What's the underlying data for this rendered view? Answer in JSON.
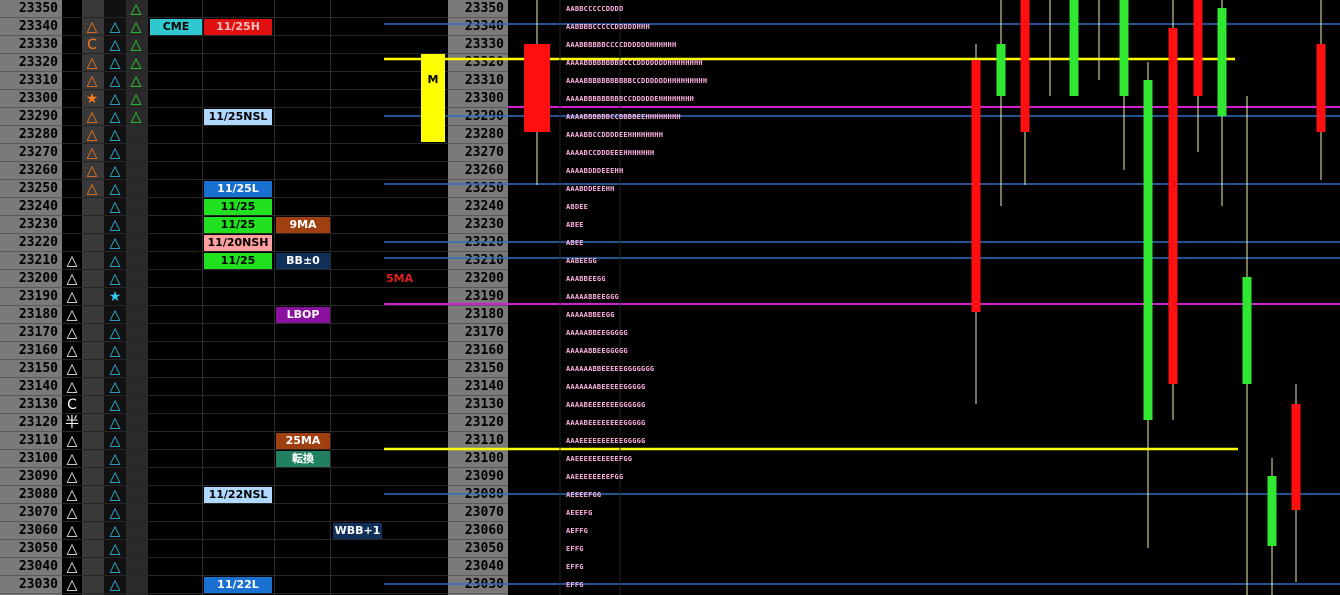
{
  "prices": [
    "23350",
    "23340",
    "23330",
    "23320",
    "23310",
    "23300",
    "23290",
    "23280",
    "23270",
    "23260",
    "23250",
    "23240",
    "23230",
    "23220",
    "23210",
    "23200",
    "23190",
    "23180",
    "23170",
    "23160",
    "23150",
    "23140",
    "23130",
    "23120",
    "23110",
    "23100",
    "23090",
    "23080",
    "23070",
    "23060",
    "23050",
    "23040",
    "23030"
  ],
  "col1_marks": [
    {
      "row": 14,
      "glyph": "△",
      "color": "#ffffff",
      "name": "triangle-icon"
    },
    {
      "row": 15,
      "glyph": "△",
      "color": "#ffffff",
      "name": "triangle-icon"
    },
    {
      "row": 16,
      "glyph": "△",
      "color": "#ffffff",
      "name": "triangle-icon"
    },
    {
      "row": 17,
      "glyph": "△",
      "color": "#ffffff",
      "name": "triangle-icon"
    },
    {
      "row": 18,
      "glyph": "△",
      "color": "#ffffff",
      "name": "triangle-icon"
    },
    {
      "row": 19,
      "glyph": "△",
      "color": "#ffffff",
      "name": "triangle-icon"
    },
    {
      "row": 20,
      "glyph": "△",
      "color": "#ffffff",
      "name": "triangle-icon"
    },
    {
      "row": 21,
      "glyph": "△",
      "color": "#ffffff",
      "name": "triangle-icon"
    },
    {
      "row": 22,
      "glyph": "C",
      "color": "#ffffff",
      "name": "c-mark-icon"
    },
    {
      "row": 23,
      "glyph": "半",
      "color": "#ffffff",
      "name": "half-mark-icon"
    },
    {
      "row": 24,
      "glyph": "△",
      "color": "#ffffff",
      "name": "triangle-icon"
    },
    {
      "row": 25,
      "glyph": "△",
      "color": "#ffffff",
      "name": "triangle-icon"
    },
    {
      "row": 26,
      "glyph": "△",
      "color": "#ffffff",
      "name": "triangle-icon"
    },
    {
      "row": 27,
      "glyph": "△",
      "color": "#ffffff",
      "name": "triangle-icon"
    },
    {
      "row": 28,
      "glyph": "△",
      "color": "#ffffff",
      "name": "triangle-icon"
    },
    {
      "row": 29,
      "glyph": "△",
      "color": "#ffffff",
      "name": "triangle-icon"
    },
    {
      "row": 30,
      "glyph": "△",
      "color": "#ffffff",
      "name": "triangle-icon"
    },
    {
      "row": 31,
      "glyph": "△",
      "color": "#ffffff",
      "name": "triangle-icon"
    },
    {
      "row": 32,
      "glyph": "△",
      "color": "#ffffff",
      "name": "triangle-icon"
    }
  ],
  "col2_marks": [
    {
      "row": 1,
      "glyph": "△",
      "color": "#ff7a20",
      "name": "triangle-icon"
    },
    {
      "row": 2,
      "glyph": "C",
      "color": "#ff7a20",
      "name": "c-mark-icon"
    },
    {
      "row": 3,
      "glyph": "△",
      "color": "#ff7a20",
      "name": "triangle-icon"
    },
    {
      "row": 4,
      "glyph": "△",
      "color": "#ff7a20",
      "name": "triangle-icon"
    },
    {
      "row": 5,
      "glyph": "★",
      "color": "#ff7a20",
      "name": "star-icon"
    },
    {
      "row": 6,
      "glyph": "△",
      "color": "#ff7a20",
      "name": "triangle-icon"
    },
    {
      "row": 7,
      "glyph": "△",
      "color": "#ff7a20",
      "name": "triangle-icon"
    },
    {
      "row": 8,
      "glyph": "△",
      "color": "#ff7a20",
      "name": "triangle-icon"
    },
    {
      "row": 9,
      "glyph": "△",
      "color": "#ff7a20",
      "name": "triangle-icon"
    },
    {
      "row": 10,
      "glyph": "△",
      "color": "#ff7a20",
      "name": "triangle-icon"
    }
  ],
  "col3_marks_all_rows": {
    "from": 1,
    "to": 32,
    "glyph": "△",
    "color": "#30c8f0",
    "star_row": 16,
    "star_glyph": "★"
  },
  "col4_marks": [
    {
      "row": 0,
      "glyph": "△",
      "color": "#30e030",
      "name": "triangle-icon"
    },
    {
      "row": 1,
      "glyph": "△",
      "color": "#30e030",
      "name": "triangle-icon"
    },
    {
      "row": 2,
      "glyph": "△",
      "color": "#30e030",
      "name": "triangle-icon"
    },
    {
      "row": 3,
      "glyph": "△",
      "color": "#30e030",
      "name": "triangle-icon"
    },
    {
      "row": 4,
      "glyph": "△",
      "color": "#30e030",
      "name": "triangle-icon"
    },
    {
      "row": 5,
      "glyph": "△",
      "color": "#30e030",
      "name": "triangle-icon"
    },
    {
      "row": 6,
      "glyph": "△",
      "color": "#30e030",
      "name": "triangle-icon"
    }
  ],
  "labels": [
    {
      "row": 1,
      "col": "a",
      "text": "CME",
      "bg": "#30c8d0",
      "fg": "#000000"
    },
    {
      "row": 1,
      "col": "b",
      "text": "11/25H",
      "bg": "#e01010",
      "fg": "#ffc0c0"
    },
    {
      "row": 6,
      "col": "b",
      "text": "11/25NSL",
      "bg": "#b0d8ff",
      "fg": "#000000"
    },
    {
      "row": 10,
      "col": "b",
      "text": "11/25L",
      "bg": "#1a70d0",
      "fg": "#ffffff"
    },
    {
      "row": 11,
      "col": "b",
      "text": "11/25",
      "bg": "#20e020",
      "fg": "#000000"
    },
    {
      "row": 12,
      "col": "b",
      "text": "11/25",
      "bg": "#20e020",
      "fg": "#000000"
    },
    {
      "row": 12,
      "col": "c",
      "text": "9MA",
      "bg": "#a04010",
      "fg": "#ffffff"
    },
    {
      "row": 13,
      "col": "b",
      "text": "11/20NSH",
      "bg": "#ffa0a0",
      "fg": "#000000"
    },
    {
      "row": 14,
      "col": "b",
      "text": "11/25",
      "bg": "#20e020",
      "fg": "#000000"
    },
    {
      "row": 14,
      "col": "c",
      "text": "BB±0",
      "bg": "#10305a",
      "fg": "#ffffff"
    },
    {
      "row": 17,
      "col": "c",
      "text": "LBOP",
      "bg": "#8a10a0",
      "fg": "#ffffff"
    },
    {
      "row": 24,
      "col": "c",
      "text": "25MA",
      "bg": "#a04010",
      "fg": "#ffffff"
    },
    {
      "row": 25,
      "col": "c",
      "text": "転換",
      "bg": "#208060",
      "fg": "#ffffff"
    },
    {
      "row": 27,
      "col": "b",
      "text": "11/22NSL",
      "bg": "#b0d8ff",
      "fg": "#000000"
    },
    {
      "row": 29,
      "col": "d",
      "text": "WBB+1",
      "bg": "#10305a",
      "fg": "#ffffff"
    },
    {
      "row": 32,
      "col": "b",
      "text": "11/22L",
      "bg": "#1a70d0",
      "fg": "#ffffff"
    }
  ],
  "five_ma_label": "5MA",
  "m_label": "M",
  "tpo_rows": [
    {
      "row": 0,
      "text": "AABBCCCCCDDDD"
    },
    {
      "row": 1,
      "text": "AABBBBCCCCCDDDDDHHH"
    },
    {
      "row": 2,
      "text": "AAABBBBBBCCCCDDDDDDHHHHHH"
    },
    {
      "row": 3,
      "text": "AAAABBBBBBBBBCCCDDDDDDDHHHHHHHH"
    },
    {
      "row": 4,
      "text": "AAAABBBBBBBBBBBCCDDDDDDHHHHHHHHH"
    },
    {
      "row": 5,
      "text": "AAAABBBBBBBBBCCDDDDDEHHHHHHHH"
    },
    {
      "row": 6,
      "text": "AAAABBBBBBCCBBBBEEHHHHHHHH"
    },
    {
      "row": 7,
      "text": "AAAABBCCDDDDEEHHHHHHHH"
    },
    {
      "row": 8,
      "text": "AAAABCCDDDEEEHHHHHHH"
    },
    {
      "row": 9,
      "text": "AAAABDDDEEEHH"
    },
    {
      "row": 10,
      "text": "AAABDDEEEHH"
    },
    {
      "row": 11,
      "text": "ABDEE"
    },
    {
      "row": 12,
      "text": "ABEE"
    },
    {
      "row": 13,
      "text": "ABEE"
    },
    {
      "row": 14,
      "text": "AABEEGG"
    },
    {
      "row": 15,
      "text": "AAABBEEGG"
    },
    {
      "row": 16,
      "text": "AAAAABBEEGGG"
    },
    {
      "row": 17,
      "text": "AAAAABBEEGG"
    },
    {
      "row": 18,
      "text": "AAAAABBEEGGGGG"
    },
    {
      "row": 19,
      "text": "AAAAABBEEGGGGG"
    },
    {
      "row": 20,
      "text": "AAAAAABBEEEEEGGGGGGG"
    },
    {
      "row": 21,
      "text": "AAAAAAABEEEEEGGGGG"
    },
    {
      "row": 22,
      "text": "AAAABEEEEEEEGGGGGG"
    },
    {
      "row": 23,
      "text": "AAAABEEEEEEEEGGGGG"
    },
    {
      "row": 24,
      "text": "AAAEEEEEEEEEEGGGGG"
    },
    {
      "row": 25,
      "text": "AAEEEEEEEEEEFGG"
    },
    {
      "row": 26,
      "text": "AAEEEEEEEEFGG"
    },
    {
      "row": 27,
      "text": "AEEEEFGG"
    },
    {
      "row": 28,
      "text": "AEEEFG"
    },
    {
      "row": 29,
      "text": "AEFFG"
    },
    {
      "row": 30,
      "text": "EFFG"
    },
    {
      "row": 31,
      "text": "EFFG"
    },
    {
      "row": 32,
      "text": "EFFG"
    }
  ],
  "colors": {
    "up": "#30e830",
    "down": "#ff1010",
    "yellow": "#ffff00",
    "magenta": "#d020d0",
    "blue": "#3070c0",
    "price_bg": "#7a7a7a"
  }
}
